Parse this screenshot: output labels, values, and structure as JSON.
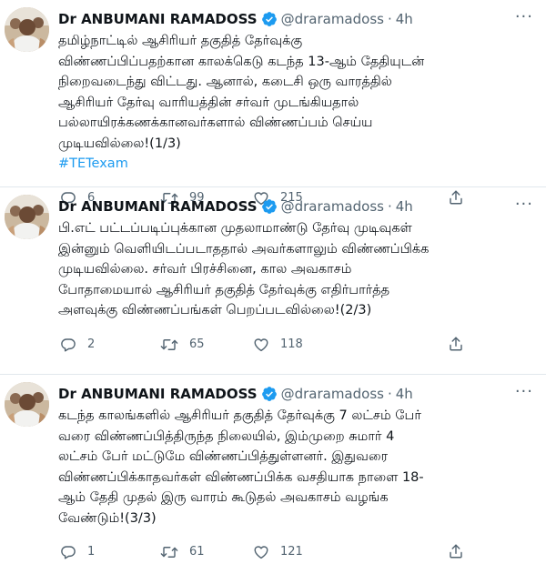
{
  "tweets": [
    {
      "name": "Dr ANBUMANI RAMADOSS",
      "handle": "@draramadoss",
      "dot": "·",
      "time": "4h",
      "lines": [
        "தமிழ்நாட்டில் ஆசிரியர் தகுதித் தேர்வுக்கு",
        "விண்ணப்பிப்பதற்கான காலக்கெடு கடந்த 13-ஆம் தேதியுடன்",
        "நிறைவடைந்து விட்டது. ஆனால், கடைசி ஒரு வாரத்தில்",
        "ஆசிரியர் தேர்வு வாரியத்தின் சர்வர் முடங்கியதால்",
        "பல்லாயிரக்கணக்கானவர்களால் விண்ணப்பம் செய்ய",
        "முடியவில்லை!(1/3)"
      ],
      "hashtag": "#TETexam",
      "replies": "6",
      "retweets": "99",
      "likes": "215"
    },
    {
      "name": "Dr ANBUMANI RAMADOSS",
      "handle": "@draramadoss",
      "dot": "·",
      "time": "4h",
      "lines": [
        "பி.எட் பட்டப்படிப்புக்கான முதலாமாண்டு தேர்வு முடிவுகள்",
        "இன்னும் வெளியிடப்படாததால் அவர்களாலும் விண்ணப்பிக்க",
        "முடியவில்லை. சர்வர் பிரச்சினை, கால அவகாசம்",
        "போதாமையால் ஆசிரியர் தகுதித் தேர்வுக்கு எதிர்பார்த்த",
        "அளவுக்கு விண்ணப்பங்கள் பெறப்படவில்லை!(2/3)"
      ],
      "hashtag": "",
      "replies": "2",
      "retweets": "65",
      "likes": "118"
    },
    {
      "name": "Dr ANBUMANI RAMADOSS",
      "handle": "@draramadoss",
      "dot": "·",
      "time": "4h",
      "lines": [
        "கடந்த காலங்களில் ஆசிரியர் தகுதித் தேர்வுக்கு 7 லட்சம் பேர்",
        "வரை விண்ணப்பித்திருந்த நிலையில், இம்முறை சுமார் 4",
        "லட்சம் பேர் மட்டுமே விண்ணப்பித்துள்ளனர். இதுவரை",
        "விண்ணப்பிக்காதவர்கள் விண்ணப்பிக்க வசதியாக நாளை 18-",
        "ஆம் தேதி முதல் இரு வாரம் கூடுதல் அவகாசம் வழங்க",
        "வேண்டும்!(3/3)"
      ],
      "hashtag": "",
      "replies": "1",
      "retweets": "61",
      "likes": "121"
    }
  ],
  "colors": {
    "accent": "#1d9bf0",
    "verified": "#1d9bf0",
    "muted": "#536471",
    "text": "#0f1419",
    "divider": "#e1e8ed"
  },
  "icons": {
    "reply": "speech-bubble-icon",
    "retweet": "retweet-arrows-icon",
    "like": "heart-icon",
    "share": "share-upload-icon",
    "verified": "verified-badge-icon",
    "more": "more-dots-icon"
  }
}
